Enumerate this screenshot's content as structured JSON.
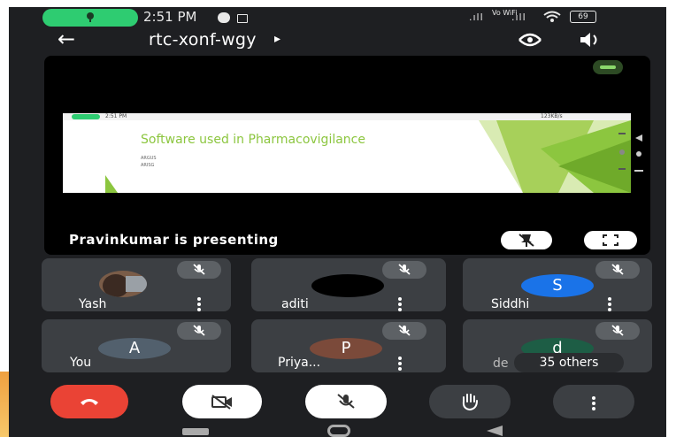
{
  "status_bar": {
    "time": "2:51 PM",
    "network": "Vo WiFi",
    "battery": "69"
  },
  "app_bar": {
    "meeting_code": "rtc-xonf-wgy",
    "back_label": "←",
    "arrow_label": "▸"
  },
  "presentation": {
    "presenter_text": "Pravinkumar is presenting",
    "slide_title": "Software used in Pharmacovigilance",
    "slide_bullets": [
      "ARGUS",
      "ARISG"
    ],
    "slide_status": "2:51 PM",
    "slide_status_right": "123KB/s"
  },
  "participants": [
    {
      "name": "Yash",
      "initial": "",
      "color": "#7a5c48"
    },
    {
      "name": "aditi",
      "initial": "",
      "color": "#000000"
    },
    {
      "name": "Siddhi",
      "initial": "S",
      "color": "#1a73e8"
    },
    {
      "name": "You",
      "initial": "A",
      "color": "#52606d"
    },
    {
      "name": "Priya...",
      "initial": "P",
      "color": "#7b4a3a"
    },
    {
      "name": "de",
      "initial": "d",
      "color": "#1d5d45"
    }
  ],
  "others_count_label": "35 others",
  "controls": {
    "end_call_color": "#ea4335",
    "button_light": "#ffffff",
    "button_dark": "#3c3f43"
  }
}
